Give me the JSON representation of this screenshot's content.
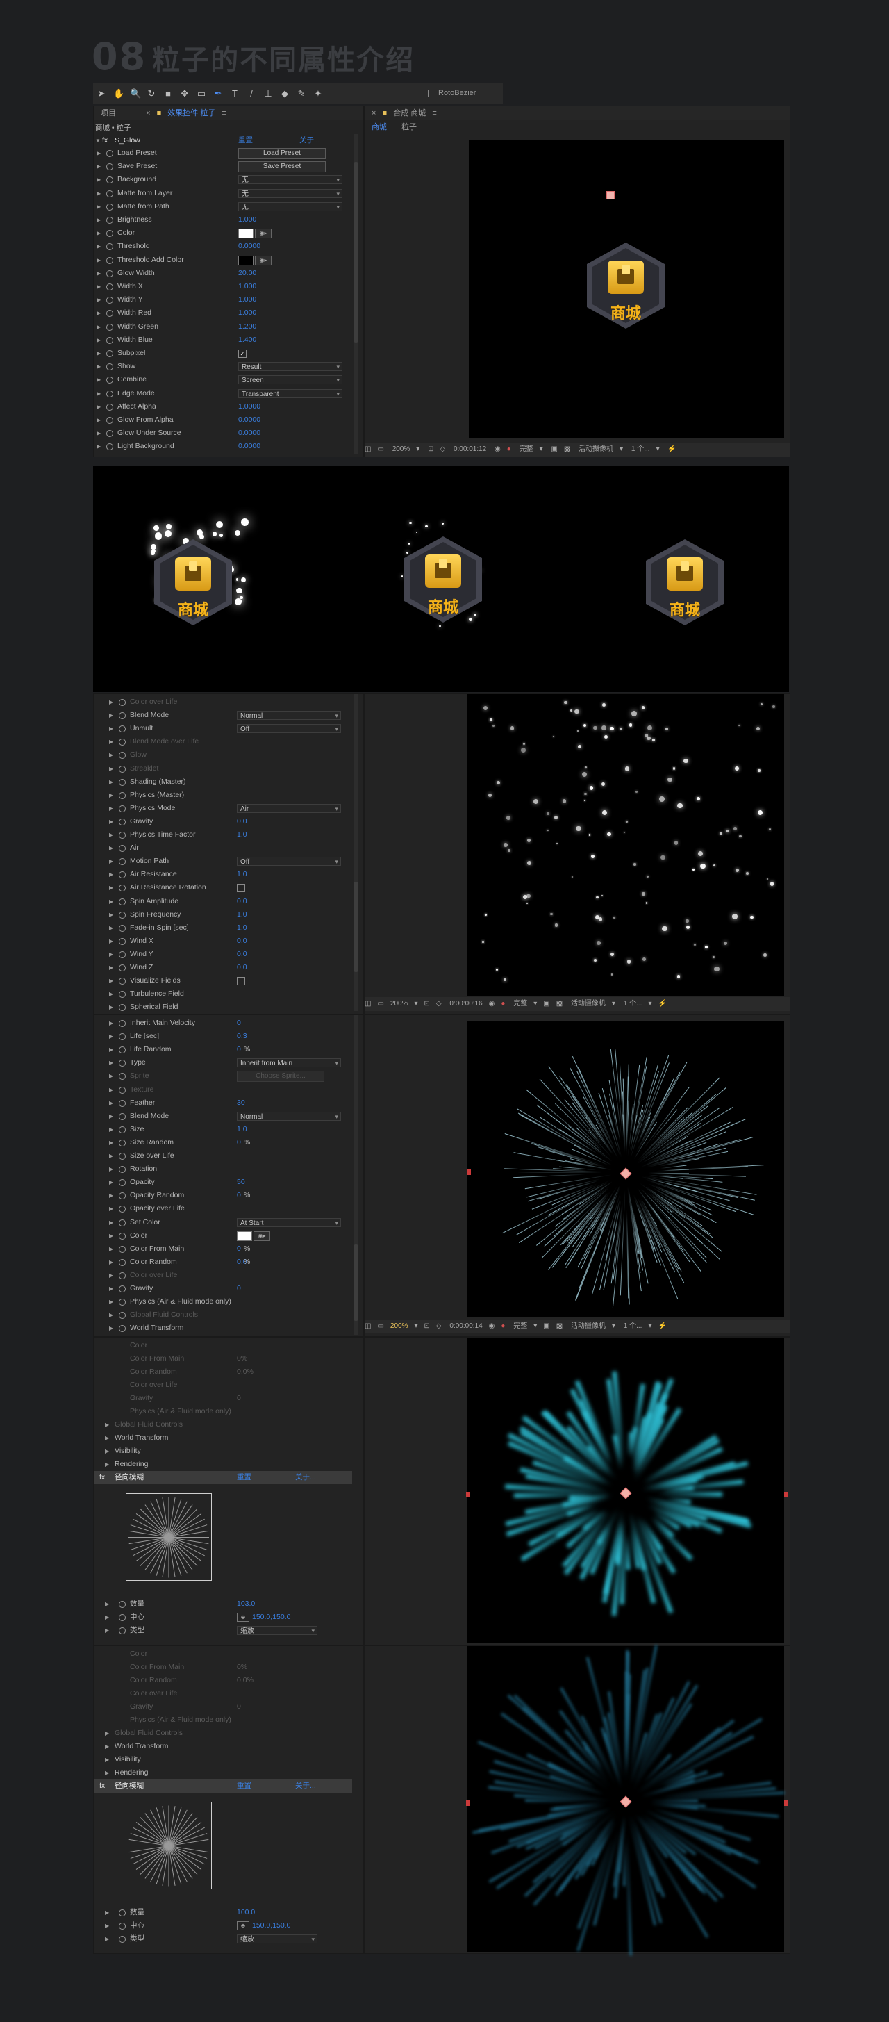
{
  "header": {
    "number": "08",
    "title": "粒子的不同属性介绍"
  },
  "toolbar": {
    "rotobezier": "RotoBezier"
  },
  "panel1": {
    "tab_project": "项目",
    "tab_effects": "效果控件 粒子",
    "breadcrumb": "商城 • 粒子",
    "effect_name": "S_Glow",
    "reset": "重置",
    "about": "关于...",
    "rows": [
      {
        "name": "Load Preset",
        "btn": "Load Preset"
      },
      {
        "name": "Save Preset",
        "btn": "Save Preset"
      },
      {
        "name": "Background",
        "dd": "无"
      },
      {
        "name": "Matte from Layer",
        "dd": "无"
      },
      {
        "name": "Matte from Path",
        "dd": "无"
      },
      {
        "name": "Brightness",
        "val": "1.000"
      },
      {
        "name": "Color",
        "color": "#ffffff"
      },
      {
        "name": "Threshold",
        "val": "0.0000"
      },
      {
        "name": "Threshold Add Color",
        "color": "#000000"
      },
      {
        "name": "Glow Width",
        "val": "20.00"
      },
      {
        "name": "Width X",
        "val": "1.000"
      },
      {
        "name": "Width Y",
        "val": "1.000"
      },
      {
        "name": "Width Red",
        "val": "1.000"
      },
      {
        "name": "Width Green",
        "val": "1.200"
      },
      {
        "name": "Width Blue",
        "val": "1.400"
      },
      {
        "name": "Subpixel",
        "check": "✓"
      },
      {
        "name": "Show",
        "dd": "Result"
      },
      {
        "name": "Combine",
        "dd": "Screen"
      },
      {
        "name": "Edge Mode",
        "dd": "Transparent"
      },
      {
        "name": "Affect Alpha",
        "val": "1.0000"
      },
      {
        "name": "Glow From Alpha",
        "val": "0.0000"
      },
      {
        "name": "Glow Under Source",
        "val": "0.0000"
      },
      {
        "name": "Light Background",
        "val": "0.0000"
      }
    ]
  },
  "comp1": {
    "tab_comp": "合成 商城",
    "tab_main": "商城",
    "tab_layer": "粒子",
    "zoom": "200%",
    "timecode": "0:00:01:12",
    "quality": "完整",
    "camera": "活动摄像机",
    "views": "1 个...",
    "badge_label": "商城"
  },
  "strip": {
    "badges": [
      "商城",
      "商城",
      "商城"
    ]
  },
  "panel2": {
    "rows": [
      {
        "name": "Color over Life",
        "dim": true
      },
      {
        "name": "Blend Mode",
        "dd": "Normal"
      },
      {
        "name": "Unmult",
        "dd": "Off"
      },
      {
        "name": "Blend Mode over Life",
        "dim": true
      },
      {
        "name": "Glow",
        "dim": true
      },
      {
        "name": "Streaklet",
        "dim": true
      },
      {
        "name": "Shading (Master)"
      },
      {
        "name": "Physics (Master)"
      },
      {
        "name": "Physics Model",
        "dd": "Air"
      },
      {
        "name": "Gravity",
        "val": "0.0"
      },
      {
        "name": "Physics Time Factor",
        "val": "1.0"
      },
      {
        "name": "Air"
      },
      {
        "name": "Motion Path",
        "dd": "Off"
      },
      {
        "name": "Air Resistance",
        "val": "1.0"
      },
      {
        "name": "Air Resistance Rotation",
        "check": ""
      },
      {
        "name": "Spin Amplitude",
        "val": "0.0"
      },
      {
        "name": "Spin Frequency",
        "val": "1.0"
      },
      {
        "name": "Fade-in Spin [sec]",
        "val": "1.0"
      },
      {
        "name": "Wind X",
        "val": "0.0"
      },
      {
        "name": "Wind Y",
        "val": "0.0"
      },
      {
        "name": "Wind Z",
        "val": "0.0"
      },
      {
        "name": "Visualize Fields",
        "check": ""
      },
      {
        "name": "Turbulence Field"
      },
      {
        "name": "Spherical Field"
      }
    ],
    "zoom": "200%",
    "timecode": "0:00:00:16",
    "quality": "完整",
    "camera": "活动摄像机",
    "views": "1 个..."
  },
  "panel3": {
    "rows": [
      {
        "name": "Inherit Main Velocity",
        "val": "0"
      },
      {
        "name": "Life [sec]",
        "val": "0.3"
      },
      {
        "name": "Life Random",
        "val": "0",
        "unit": "%"
      },
      {
        "name": "Type",
        "dd": "Inherit from Main"
      },
      {
        "name": "Sprite",
        "dim": true,
        "btn": "Choose Sprite..."
      },
      {
        "name": "Texture",
        "dim": true
      },
      {
        "name": "Feather",
        "val": "30"
      },
      {
        "name": "Blend Mode",
        "dd": "Normal"
      },
      {
        "name": "Size",
        "val": "1.0"
      },
      {
        "name": "Size Random",
        "val": "0",
        "unit": "%"
      },
      {
        "name": "Size over Life"
      },
      {
        "name": "Rotation"
      },
      {
        "name": "Opacity",
        "val": "50"
      },
      {
        "name": "Opacity Random",
        "val": "0",
        "unit": "%"
      },
      {
        "name": "Opacity over Life"
      },
      {
        "name": "Set Color",
        "dd": "At Start"
      },
      {
        "name": "Color",
        "color": "#ffffff"
      },
      {
        "name": "Color From Main",
        "val": "0",
        "unit": "%"
      },
      {
        "name": "Color Random",
        "val": "0.0",
        "unit": "%"
      },
      {
        "name": "Color over Life",
        "dim": true
      },
      {
        "name": "Gravity",
        "val": "0"
      },
      {
        "name": "Physics (Air & Fluid mode only)"
      },
      {
        "name": "Global Fluid Controls",
        "dim": true
      },
      {
        "name": "World Transform"
      }
    ],
    "zoom": "200%",
    "timecode": "0:00:00:14",
    "quality": "完整",
    "camera": "活动摄像机",
    "views": "1 个..."
  },
  "panel4": {
    "dim_rows": [
      {
        "name": "Color"
      },
      {
        "name": "Color From Main",
        "val": "0%"
      },
      {
        "name": "Color Random",
        "val": "0.0%"
      },
      {
        "name": "Color over Life"
      },
      {
        "name": "Gravity",
        "val": "0"
      },
      {
        "name": "Physics (Air & Fluid mode only)"
      }
    ],
    "groups": [
      "Global Fluid Controls",
      "World Transform",
      "Visibility",
      "Rendering"
    ],
    "effect": "径向模糊",
    "reset": "重置",
    "about": "关于...",
    "amount_label": "数量",
    "amount": "103.0",
    "center_label": "中心",
    "center": "150.0,150.0",
    "type_label": "类型",
    "type": "缩放"
  },
  "panel5": {
    "dim_rows": [
      {
        "name": "Color"
      },
      {
        "name": "Color From Main",
        "val": "0%"
      },
      {
        "name": "Color Random",
        "val": "0.0%"
      },
      {
        "name": "Color over Life"
      },
      {
        "name": "Gravity",
        "val": "0"
      },
      {
        "name": "Physics (Air & Fluid mode only)"
      }
    ],
    "groups": [
      "Global Fluid Controls",
      "World Transform",
      "Visibility",
      "Rendering"
    ],
    "effect": "径向模糊",
    "reset": "重置",
    "about": "关于...",
    "amount_label": "数量",
    "amount": "100.0",
    "center_label": "中心",
    "center": "150.0,150.0",
    "type_label": "类型",
    "type": "缩放"
  }
}
